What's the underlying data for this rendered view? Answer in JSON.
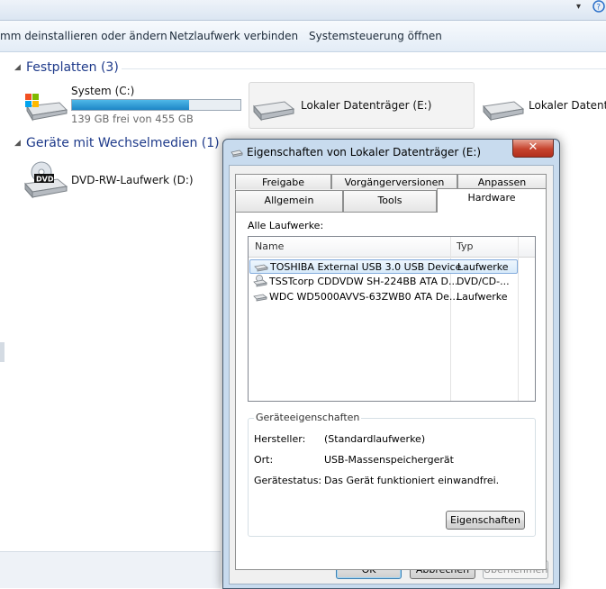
{
  "commands": [
    "mm deinstallieren oder ändern",
    "Netzlaufwerk verbinden",
    "Systemsteuerung öffnen"
  ],
  "groups": {
    "hdd": {
      "title": "Festplatten (3)"
    },
    "removable": {
      "title": "Geräte mit Wechselmedien (1)"
    }
  },
  "drives": {
    "c": {
      "name": "System (C:)",
      "free": "139 GB frei von 455 GB",
      "used_fraction": 0.695
    },
    "e": {
      "name": "Lokaler Datenträger (E:)"
    },
    "third": {
      "name": "Lokaler Datenträ"
    },
    "d": {
      "name": "DVD-RW-Laufwerk (D:)",
      "icon_text": "DVD"
    }
  },
  "dialog": {
    "title": "Eigenschaften von Lokaler Datenträger (E:)",
    "close": "✕",
    "tabs_back": [
      "Freigabe",
      "Vorgängerversionen",
      "Anpassen"
    ],
    "tabs_front": [
      "Allgemein",
      "Tools",
      "Hardware"
    ],
    "all_drives_label": "Alle Laufwerke:",
    "columns": {
      "name": "Name",
      "type": "Typ"
    },
    "rows": [
      {
        "name": "TOSHIBA External USB 3.0 USB Device",
        "type": "Laufwerke"
      },
      {
        "name": "TSSTcorp CDDVDW SH-224BB ATA D...",
        "type": "DVD/CD-..."
      },
      {
        "name": "WDC WD5000AVVS-63ZWB0 ATA De...",
        "type": "Laufwerke"
      }
    ],
    "props": {
      "title": "Geräteeigenschaften",
      "manufacturer_label": "Hersteller:",
      "manufacturer": "(Standardlaufwerke)",
      "location_label": "Ort:",
      "location": "USB-Massenspeichergerät",
      "status_label": "Gerätestatus:",
      "status": "Das Gerät funktioniert einwandfrei.",
      "properties_button": "Eigenschaften"
    },
    "buttons": {
      "ok": "OK",
      "cancel": "Abbrechen",
      "apply": "Übernehmen"
    }
  }
}
